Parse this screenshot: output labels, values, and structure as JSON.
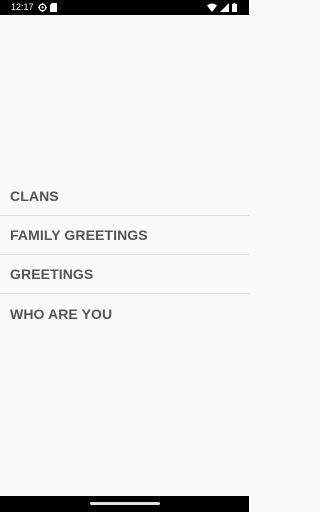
{
  "status_bar": {
    "time": "12:17",
    "left_icons": [
      "settings-gear-icon",
      "sim-card-icon"
    ],
    "right_icons": [
      "wifi-icon",
      "signal-icon",
      "battery-icon"
    ]
  },
  "menu": {
    "items": [
      {
        "label": "CLANS"
      },
      {
        "label": "FAMILY GREETINGS"
      },
      {
        "label": "GREETINGS"
      },
      {
        "label": "WHO ARE YOU"
      }
    ]
  },
  "colors": {
    "background": "#fafafa",
    "label": "#555555",
    "divider": "#dcdcdc",
    "system_bars": "#000000"
  }
}
